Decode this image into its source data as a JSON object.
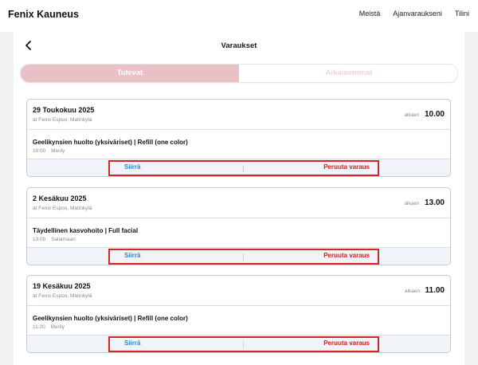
{
  "nav": {
    "brand": "Fenix Kauneus",
    "links": [
      "Meistä",
      "Ajanvaraukseni",
      "Tilini"
    ]
  },
  "page": {
    "title": "Varaukset",
    "back_icon": "chevron-left-icon"
  },
  "tabs": [
    {
      "label": "Tulevat",
      "active": true
    },
    {
      "label": "Aikaisemmat",
      "active": false
    }
  ],
  "bookings": [
    {
      "date": "29 Toukokuu 2025",
      "location": "at Fenix Espoo, Matinkylä",
      "time_prefix": "alkaen",
      "time": "10.00",
      "service": "Geelikynsien huolto (yksiväriset) | Refill (one color)",
      "service_time": "10:00",
      "staff": "Merily",
      "move_label": "Siirrä",
      "cancel_label": "Peruuta varaus"
    },
    {
      "date": "2 Kesäkuu 2025",
      "location": "at Fenix Espoo, Matinkylä",
      "time_prefix": "alkaen",
      "time": "13.00",
      "service": "Täydellinen kasvohoito | Full facial",
      "service_time": "13:00",
      "staff": "Saliamaari",
      "move_label": "Siirrä",
      "cancel_label": "Peruuta varaus"
    },
    {
      "date": "19 Kesäkuu 2025",
      "location": "at Fenix Espoo, Matinkylä",
      "time_prefix": "alkaen",
      "time": "11.00",
      "service": "Geelikynsien huolto (yksiväriset) | Refill (one color)",
      "service_time": "11:00",
      "staff": "Merily",
      "move_label": "Siirrä",
      "cancel_label": "Peruuta varaus"
    }
  ],
  "colors": {
    "tab_active": "#e8c0c6",
    "move_action": "#2b8ac2",
    "cancel_action": "#d0211f",
    "highlight_border": "#d52525"
  }
}
